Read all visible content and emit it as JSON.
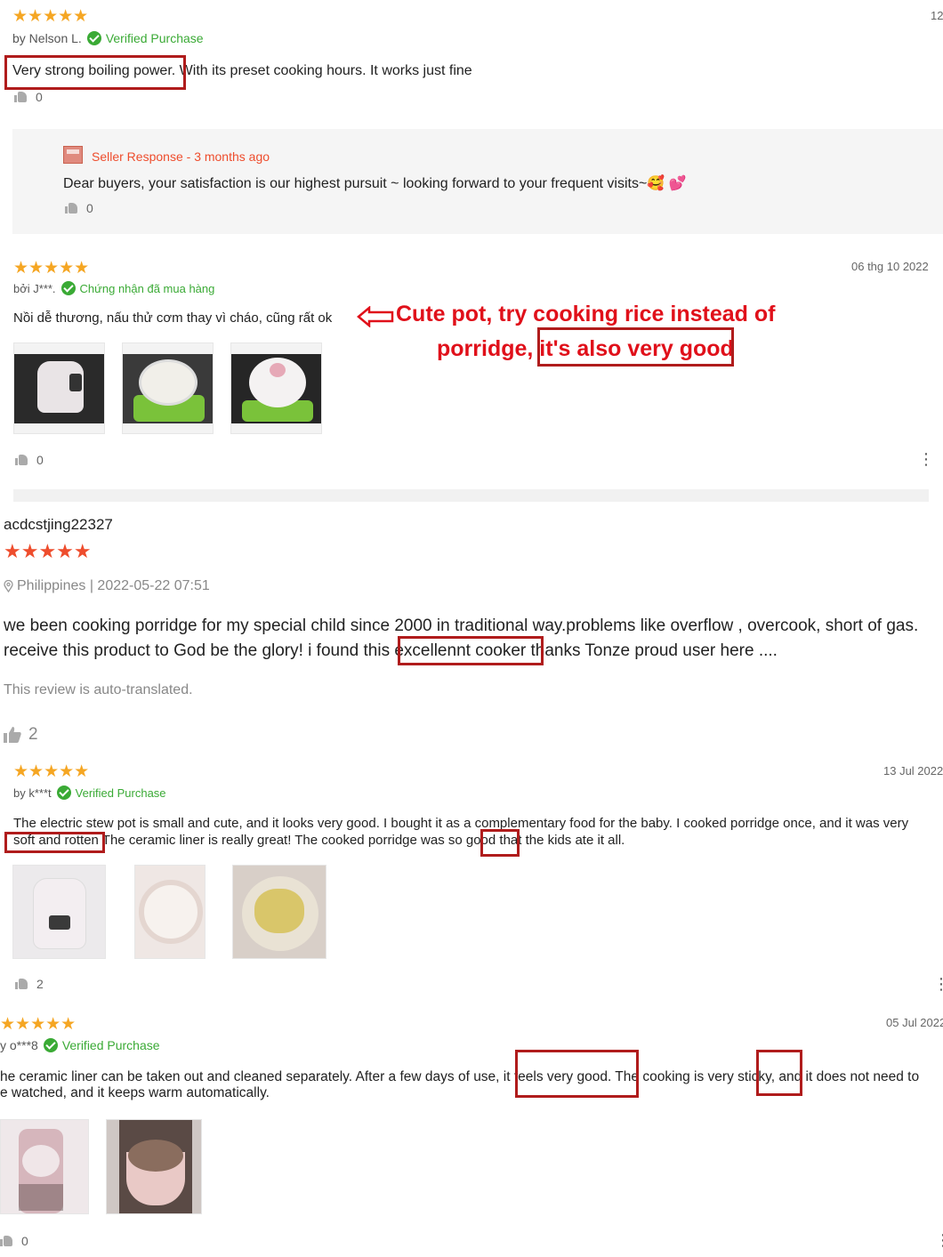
{
  "r1": {
    "stars": "★★★★★",
    "author": "by Nelson L.",
    "verified": "Verified Purchase",
    "text_a": "Very strong boiling power.",
    "text_b": " With its preset cooking hours. It works just fine",
    "likes": "0",
    "partial_date": "12",
    "seller": {
      "label": "Seller Response",
      "sep": " - ",
      "time": "3 months ago",
      "text": "Dear buyers, your satisfaction is our highest pursuit ~ looking forward to your frequent visits~",
      "emoji": "🥰 💕",
      "likes": "0"
    }
  },
  "r2": {
    "stars": "★★★★★",
    "date": "06 thg 10 2022",
    "author": "bởi J***.",
    "verified": "Chứng nhận đã mua hàng",
    "text": "Nồi dễ thương, nấu thử cơm thay vì cháo, cũng rất ok",
    "annotation_line1": "Cute pot, try cooking rice instead of",
    "annotation_line2a": "porridge, ",
    "annotation_line2b": "it's also very good",
    "likes": "0",
    "photos": [
      "pot-photo",
      "rice-photo",
      "lid-photo"
    ]
  },
  "r3": {
    "username": "acdcstjing22327",
    "stars": "★★★★★",
    "location": "Philippines | 2022-05-22 07:51",
    "line1": "we been cooking porridge for my special child since 2000 in traditional way.problems like overflow , overcook, short of gas.",
    "line2a": "receive this product to God be the glory! i found this ",
    "line2b": "excellennt cooker",
    "line2c": " thanks Tonze  proud user here ....",
    "note": "This review is auto-translated.",
    "likes": "2"
  },
  "r4": {
    "stars": "★★★★★",
    "date": "13 Jul 2022",
    "author": "by k***t",
    "verified": "Verified Purchase",
    "line1": "The electric stew pot is small and cute, and it looks very good. I bought it as a complementary food for the baby. I cooked porridge once, and it was very",
    "line2a": "soft and rotten",
    "line2b": " The ceramic liner is really great! The cooked porridge was so ",
    "line2c": "good",
    "line2d": " that the kids ate it all.",
    "likes": "2"
  },
  "r5": {
    "stars": "★★★★★",
    "date": "05 Jul 2022",
    "author": "y o***8",
    "verified": "Verified Purchase",
    "line1a": "he ceramic liner can be taken out and cleaned separately. After a few days of use, ",
    "line1b": "it feels very good.",
    "line1c": " The cooking is very ",
    "line1d": "sticky,",
    "line1e": " and it does not need to",
    "line2": "e watched, and it keeps warm automatically.",
    "likes": "0"
  },
  "colors": {
    "accent_red": "#ee4d2d",
    "verified_green": "#3aaa35",
    "highlight_box": "#b01c1c",
    "annotation": "#e0101a"
  }
}
